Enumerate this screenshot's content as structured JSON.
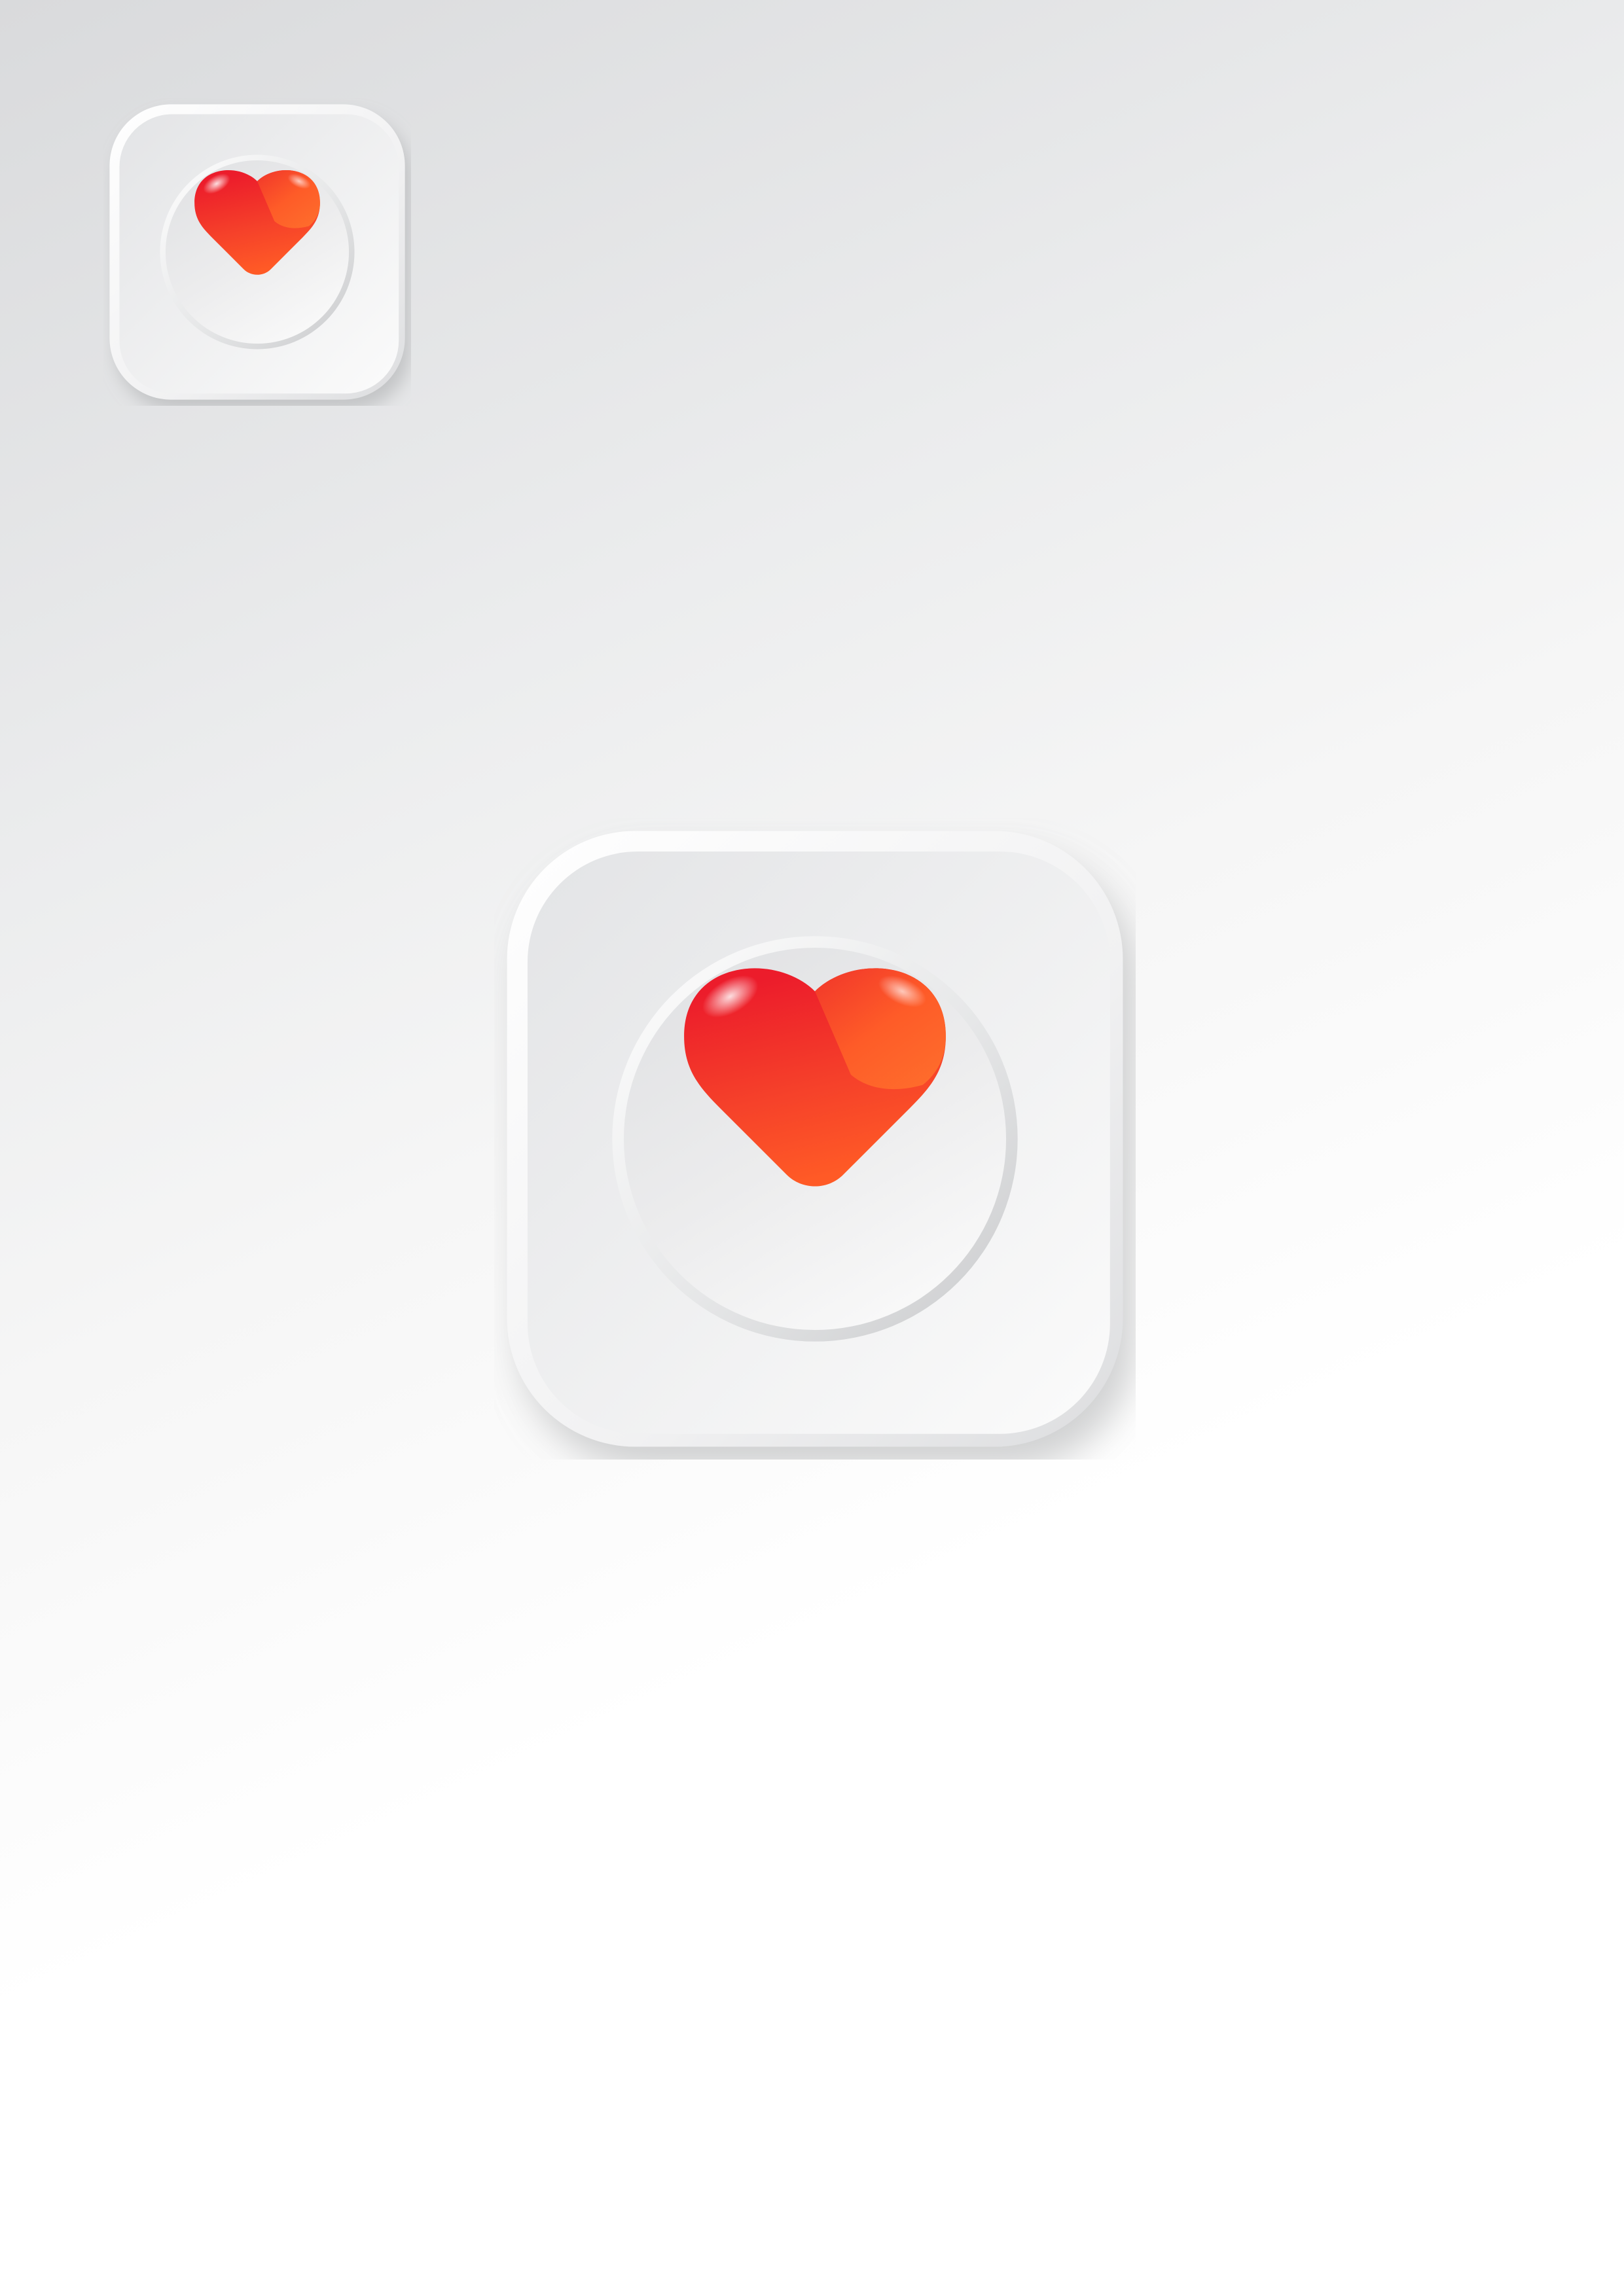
{
  "icons": [
    {
      "name": "app-icon-small",
      "symbol": "heart-icon"
    },
    {
      "name": "app-icon-large",
      "symbol": "heart-icon"
    }
  ],
  "colors": {
    "heart_top": "#ec1c2b",
    "heart_bottom": "#ff5a26",
    "heart_right_lobe": "#ff6a2a",
    "tile_light": "#f7f7f7",
    "tile_shadow": "#d4d5d7",
    "ring": "#d3d4d6"
  }
}
